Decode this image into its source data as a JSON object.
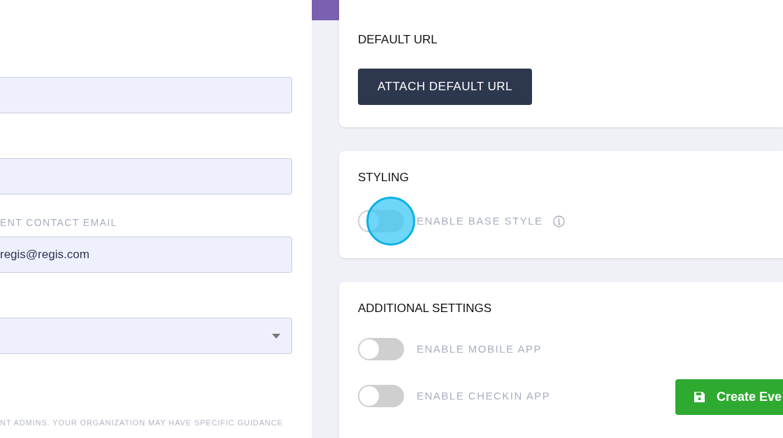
{
  "left_form": {
    "fields": [
      {
        "kind": "input"
      },
      {
        "kind": "input"
      },
      {
        "kind": "input",
        "label": "ENT CONTACT EMAIL",
        "value": "regis@regis.com"
      },
      {
        "kind": "select"
      }
    ],
    "note": "NT ADMINS. YOUR ORGANIZATION MAY HAVE SPECIFIC GUIDANCE"
  },
  "default_url": {
    "title": "DEFAULT URL",
    "button": "ATTACH DEFAULT URL"
  },
  "styling": {
    "title": "STYLING",
    "toggles": [
      {
        "label": "ENABLE BASE STYLE",
        "on": false,
        "info": true
      }
    ]
  },
  "additional_settings": {
    "title": "ADDITIONAL SETTINGS",
    "toggles": [
      {
        "label": "ENABLE MOBILE APP",
        "on": false,
        "info": false
      },
      {
        "label": "ENABLE CHECKIN APP",
        "on": false,
        "info": false
      }
    ]
  },
  "create_button": "Create Eve"
}
